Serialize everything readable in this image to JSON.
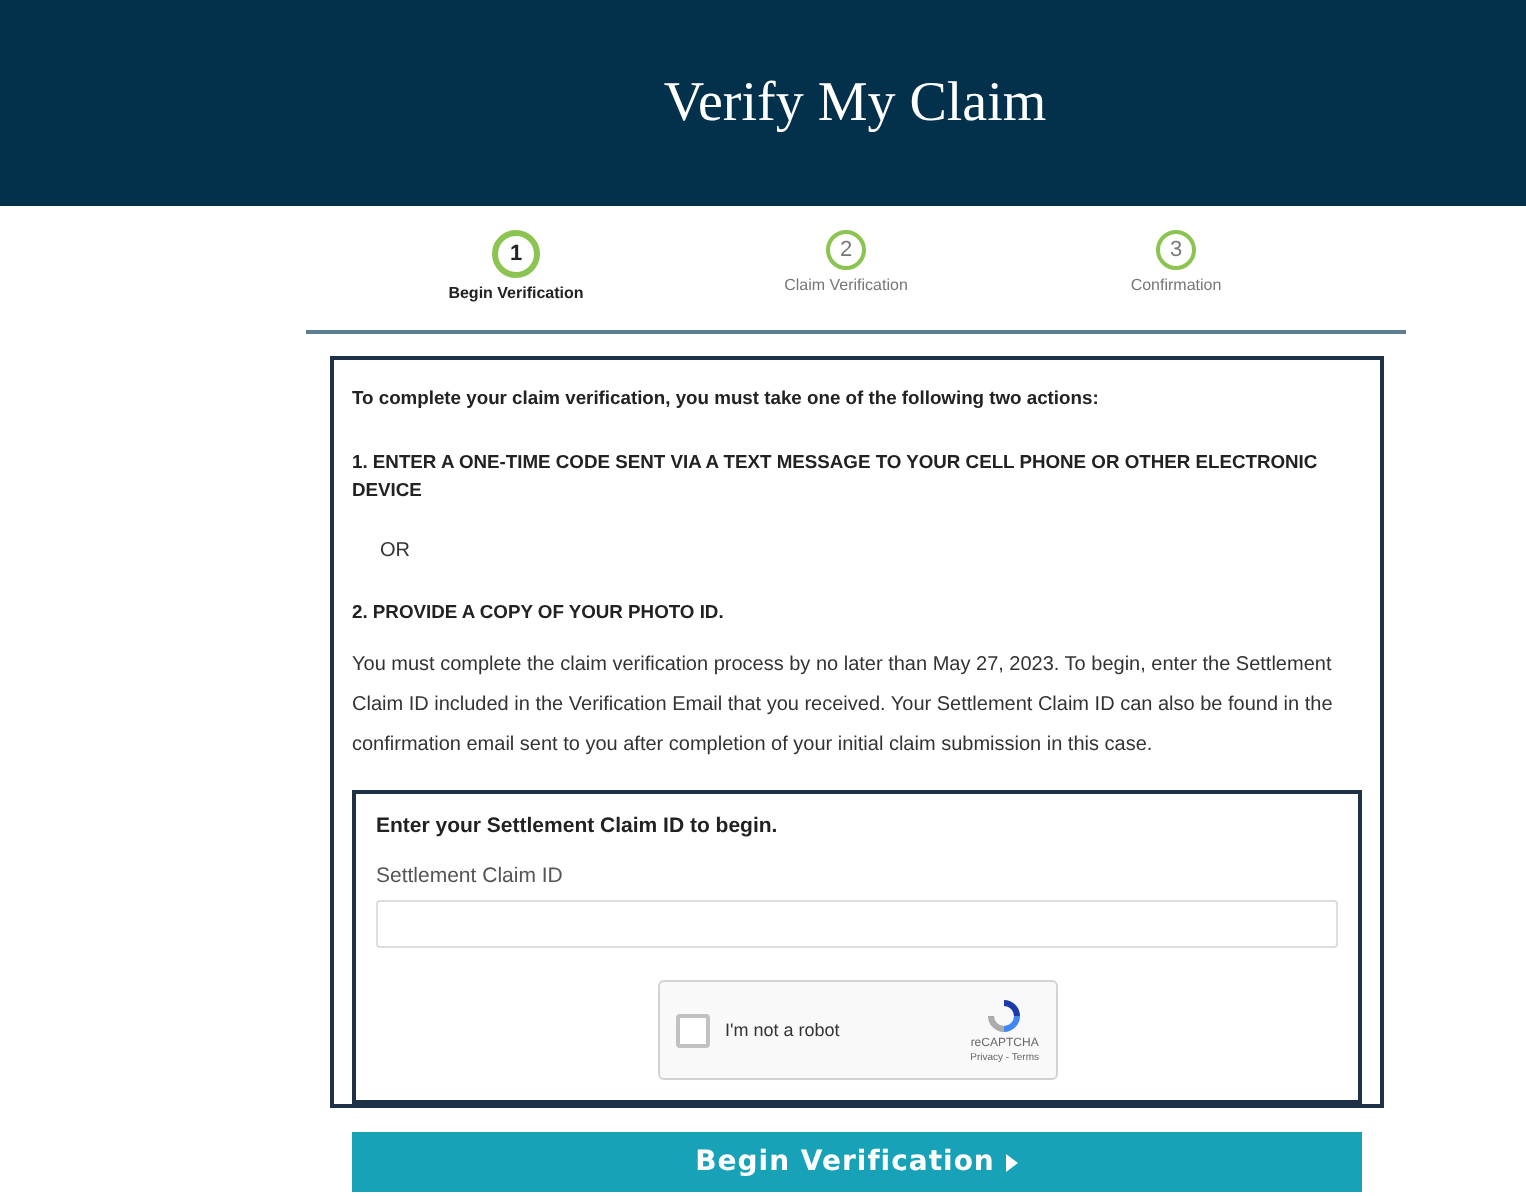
{
  "header": {
    "title": "Verify My Claim"
  },
  "steps": [
    {
      "number": "1",
      "label": "Begin Verification",
      "selected": true
    },
    {
      "number": "2",
      "label": "Claim Verification",
      "selected": false
    },
    {
      "number": "3",
      "label": "Confirmation",
      "selected": false
    }
  ],
  "instructions": {
    "intro": "To complete your claim verification, you must take one of the following two actions:",
    "option_1": "1. ENTER A ONE-TIME CODE SENT VIA A TEXT MESSAGE TO YOUR CELL PHONE OR OTHER ELECTRONIC DEVICE",
    "separator": "OR",
    "option_2": "2. PROVIDE A COPY OF YOUR PHOTO ID.",
    "paragraph": "You must complete the claim verification process by no later than May 27, 2023. To begin, enter the Settlement Claim ID included in the Verification Email that you received. Your Settlement Claim ID can also be found in the confirmation email sent to you after completion of your initial claim submission in this case."
  },
  "form": {
    "title": "Enter your Settlement Claim ID to begin.",
    "field_label": "Settlement Claim ID",
    "captcha": {
      "label": "I'm not a robot",
      "checked": false,
      "brand": "reCAPTCHA",
      "links": "Privacy - Terms"
    }
  },
  "button": {
    "label": "Begin Verification"
  }
}
